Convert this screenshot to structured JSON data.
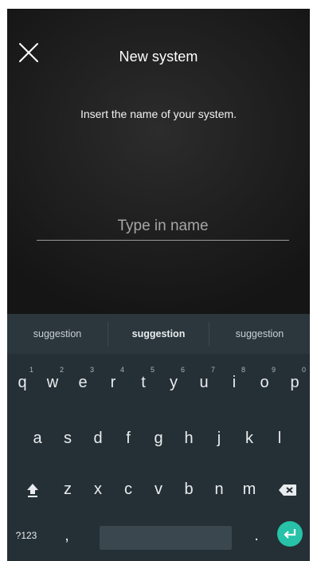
{
  "header": {
    "title": "New system",
    "close_icon": "close-icon"
  },
  "main": {
    "prompt": "Insert the name of your system.",
    "name_input": {
      "value": "",
      "placeholder": "Type in name"
    }
  },
  "keyboard": {
    "suggestions": [
      "suggestion",
      "suggestion",
      "suggestion"
    ],
    "row1": [
      {
        "key": "q",
        "hint": "1"
      },
      {
        "key": "w",
        "hint": "2"
      },
      {
        "key": "e",
        "hint": "3"
      },
      {
        "key": "r",
        "hint": "4"
      },
      {
        "key": "t",
        "hint": "5"
      },
      {
        "key": "y",
        "hint": "6"
      },
      {
        "key": "u",
        "hint": "7"
      },
      {
        "key": "i",
        "hint": "8"
      },
      {
        "key": "o",
        "hint": "9"
      },
      {
        "key": "p",
        "hint": "0"
      }
    ],
    "row2": [
      "a",
      "s",
      "d",
      "f",
      "g",
      "h",
      "j",
      "k",
      "l"
    ],
    "row3": [
      "z",
      "x",
      "c",
      "v",
      "b",
      "n",
      "m"
    ],
    "symbols_label": "?123",
    "comma_label": ",",
    "period_label": ".",
    "icons": {
      "shift": "shift-icon",
      "backspace": "backspace-icon",
      "enter": "enter-icon"
    },
    "colors": {
      "background": "#253036",
      "suggestion_bar": "#2b373d",
      "enter_accent": "#27c2a7"
    }
  }
}
